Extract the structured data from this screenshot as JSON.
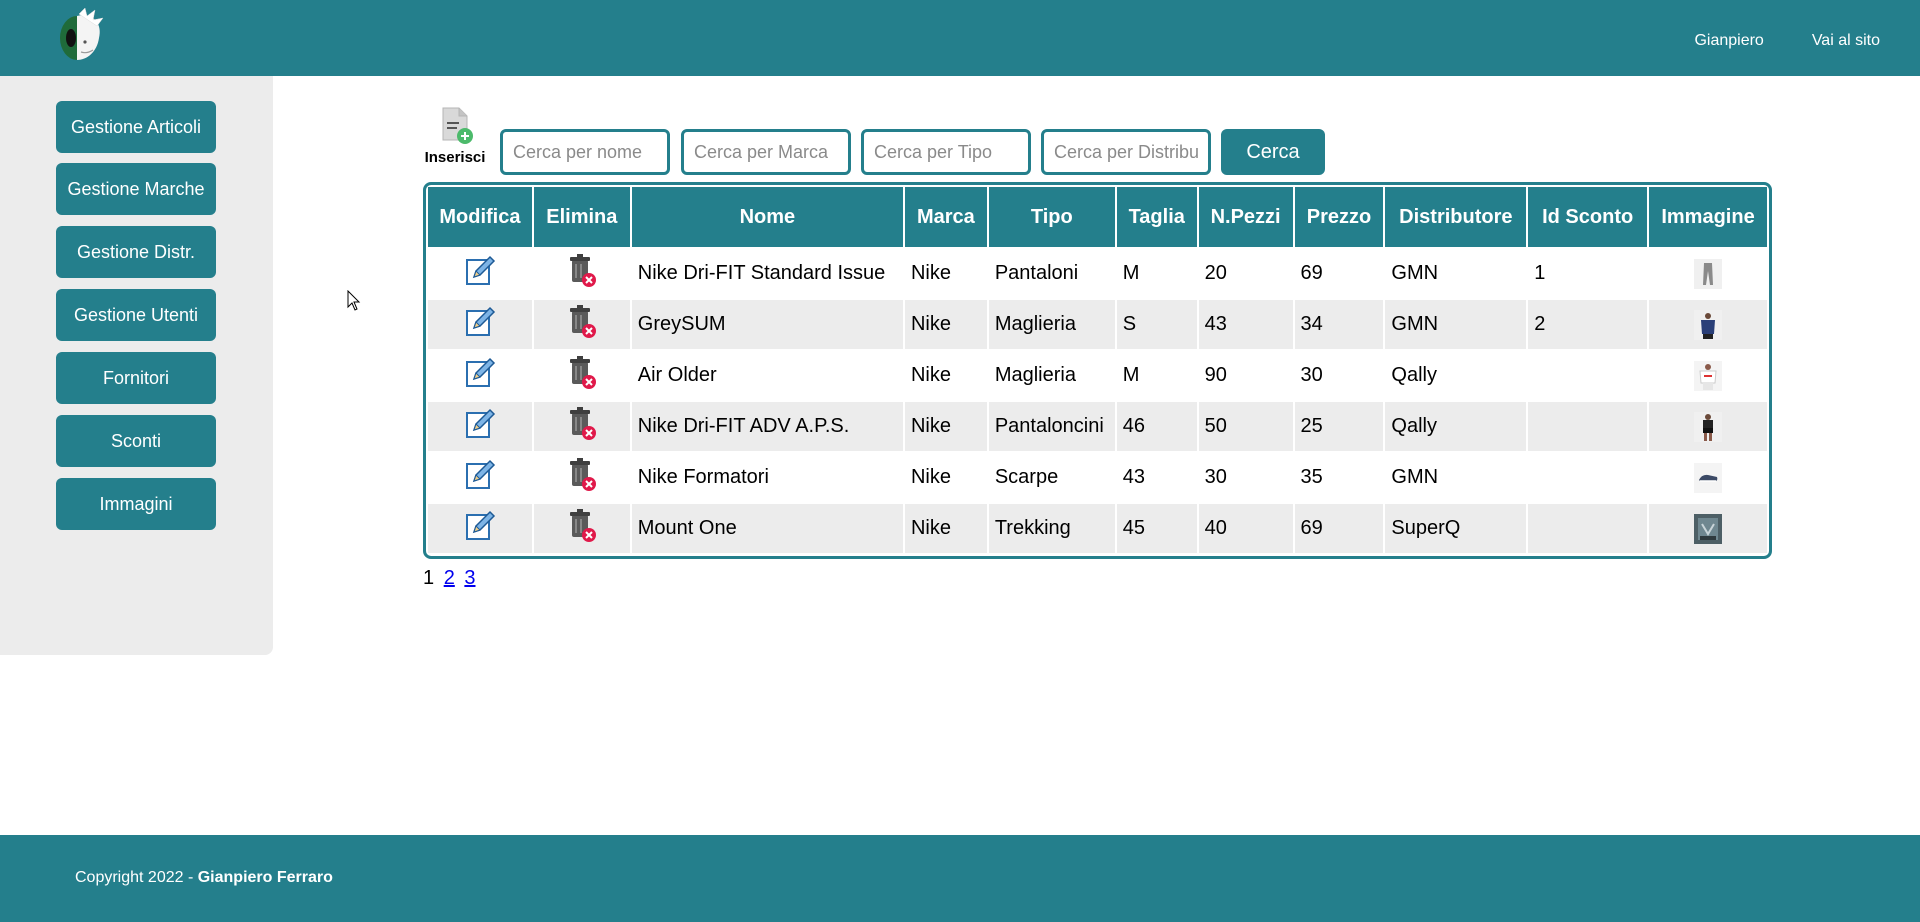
{
  "header": {
    "nav": [
      "Gianpiero",
      "Vai al sito"
    ]
  },
  "sidebar": {
    "items": [
      "Gestione Articoli",
      "Gestione Marche",
      "Gestione Distr.",
      "Gestione Utenti",
      "Fornitori",
      "Sconti",
      "Immagini"
    ]
  },
  "toolbar": {
    "insert_label": "Inserisci",
    "search_name_placeholder": "Cerca per nome",
    "search_brand_placeholder": "Cerca per Marca",
    "search_type_placeholder": "Cerca per Tipo",
    "search_distributor_placeholder": "Cerca per Distributore",
    "search_button": "Cerca"
  },
  "table": {
    "headers": [
      "Modifica",
      "Elimina",
      "Nome",
      "Marca",
      "Tipo",
      "Taglia",
      "N.Pezzi",
      "Prezzo",
      "Distributore",
      "Id Sconto",
      "Immagine"
    ],
    "rows": [
      {
        "nome": "Nike Dri-FIT Standard Issue",
        "marca": "Nike",
        "tipo": "Pantaloni",
        "taglia": "M",
        "pezzi": "20",
        "prezzo": "69",
        "distributore": "GMN",
        "sconto": "1"
      },
      {
        "nome": "GreySUM",
        "marca": "Nike",
        "tipo": "Maglieria",
        "taglia": "S",
        "pezzi": "43",
        "prezzo": "34",
        "distributore": "GMN",
        "sconto": "2"
      },
      {
        "nome": "Air Older",
        "marca": "Nike",
        "tipo": "Maglieria",
        "taglia": "M",
        "pezzi": "90",
        "prezzo": "30",
        "distributore": "Qally",
        "sconto": ""
      },
      {
        "nome": "Nike Dri-FIT ADV A.P.S.",
        "marca": "Nike",
        "tipo": "Pantaloncini",
        "taglia": "46",
        "pezzi": "50",
        "prezzo": "25",
        "distributore": "Qally",
        "sconto": ""
      },
      {
        "nome": "Nike Formatori",
        "marca": "Nike",
        "tipo": "Scarpe",
        "taglia": "43",
        "pezzi": "30",
        "prezzo": "35",
        "distributore": "GMN",
        "sconto": ""
      },
      {
        "nome": "Mount One",
        "marca": "Nike",
        "tipo": "Trekking",
        "taglia": "45",
        "pezzi": "40",
        "prezzo": "69",
        "distributore": "SuperQ",
        "sconto": ""
      }
    ]
  },
  "pagination": {
    "current": "1",
    "pages": [
      "2",
      "3"
    ]
  },
  "footer": {
    "copyright_prefix": "Copyright 2022 - ",
    "author": "Gianpiero Ferraro"
  },
  "colors": {
    "primary": "#247f8c",
    "sidebar_bg": "#ececec",
    "row_alt": "#ececec"
  }
}
